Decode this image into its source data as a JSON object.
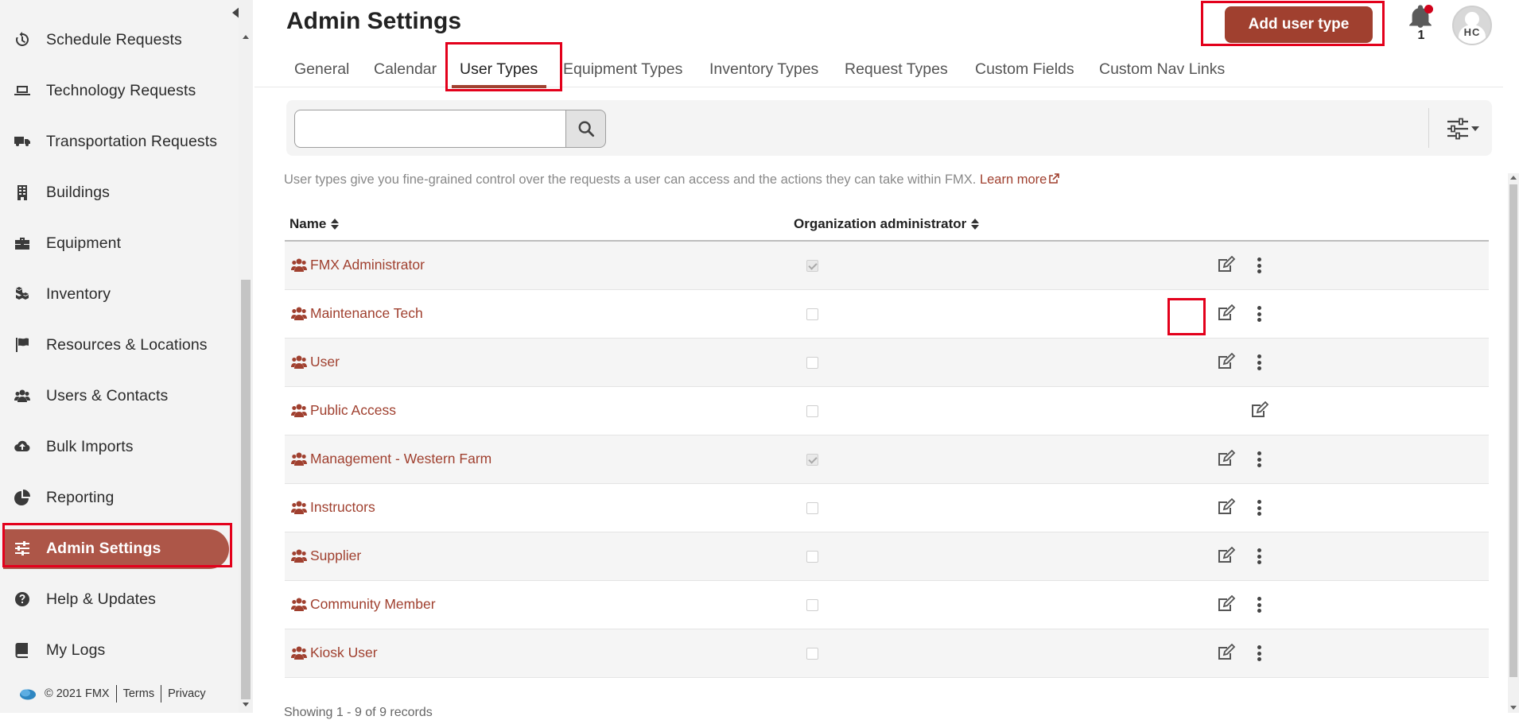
{
  "sidebar": {
    "items": [
      {
        "label": "Schedule Requests",
        "icon": "history-icon"
      },
      {
        "label": "Technology Requests",
        "icon": "laptop-icon"
      },
      {
        "label": "Transportation Requests",
        "icon": "truck-icon"
      },
      {
        "label": "Buildings",
        "icon": "building-icon"
      },
      {
        "label": "Equipment",
        "icon": "toolbox-icon"
      },
      {
        "label": "Inventory",
        "icon": "boxes-icon"
      },
      {
        "label": "Resources & Locations",
        "icon": "flag-icon"
      },
      {
        "label": "Users & Contacts",
        "icon": "users-icon"
      },
      {
        "label": "Bulk Imports",
        "icon": "cloud-upload-icon"
      },
      {
        "label": "Reporting",
        "icon": "pie-chart-icon"
      },
      {
        "label": "Admin Settings",
        "icon": "sliders-icon",
        "active": true
      },
      {
        "label": "Help & Updates",
        "icon": "question-circle-icon"
      },
      {
        "label": "My Logs",
        "icon": "book-icon"
      }
    ],
    "footer": {
      "copyright": "© 2021 FMX",
      "terms": "Terms",
      "privacy": "Privacy"
    }
  },
  "header": {
    "title": "Admin Settings",
    "add_button": "Add user type",
    "notification_count": "1",
    "avatar_initials": "HC"
  },
  "tabs": [
    {
      "label": "General"
    },
    {
      "label": "Calendar"
    },
    {
      "label": "User Types",
      "active": true
    },
    {
      "label": "Equipment Types"
    },
    {
      "label": "Inventory Types"
    },
    {
      "label": "Request Types"
    },
    {
      "label": "Custom Fields"
    },
    {
      "label": "Custom Nav Links"
    }
  ],
  "search": {
    "placeholder": "",
    "value": ""
  },
  "info": {
    "text": "User types give you fine-grained control over the requests a user can access and the actions they can take within FMX. ",
    "link": "Learn more"
  },
  "table": {
    "columns": [
      "Name",
      "Organization administrator"
    ],
    "rows": [
      {
        "name": "FMX Administrator",
        "org_admin": true,
        "has_menu": true
      },
      {
        "name": "Maintenance Tech",
        "org_admin": false,
        "has_menu": true
      },
      {
        "name": "User",
        "org_admin": false,
        "has_menu": true
      },
      {
        "name": "Public Access",
        "org_admin": false,
        "has_menu": false
      },
      {
        "name": "Management - Western Farm",
        "org_admin": true,
        "has_menu": true
      },
      {
        "name": "Instructors",
        "org_admin": false,
        "has_menu": true
      },
      {
        "name": "Supplier",
        "org_admin": false,
        "has_menu": true
      },
      {
        "name": "Community Member",
        "org_admin": false,
        "has_menu": true
      },
      {
        "name": "Kiosk User",
        "org_admin": false,
        "has_menu": true
      }
    ],
    "footer": "Showing 1 - 9 of 9 records"
  },
  "colors": {
    "brand": "#a0402f",
    "active_nav": "#ad5648",
    "highlight": "#e3001b"
  }
}
